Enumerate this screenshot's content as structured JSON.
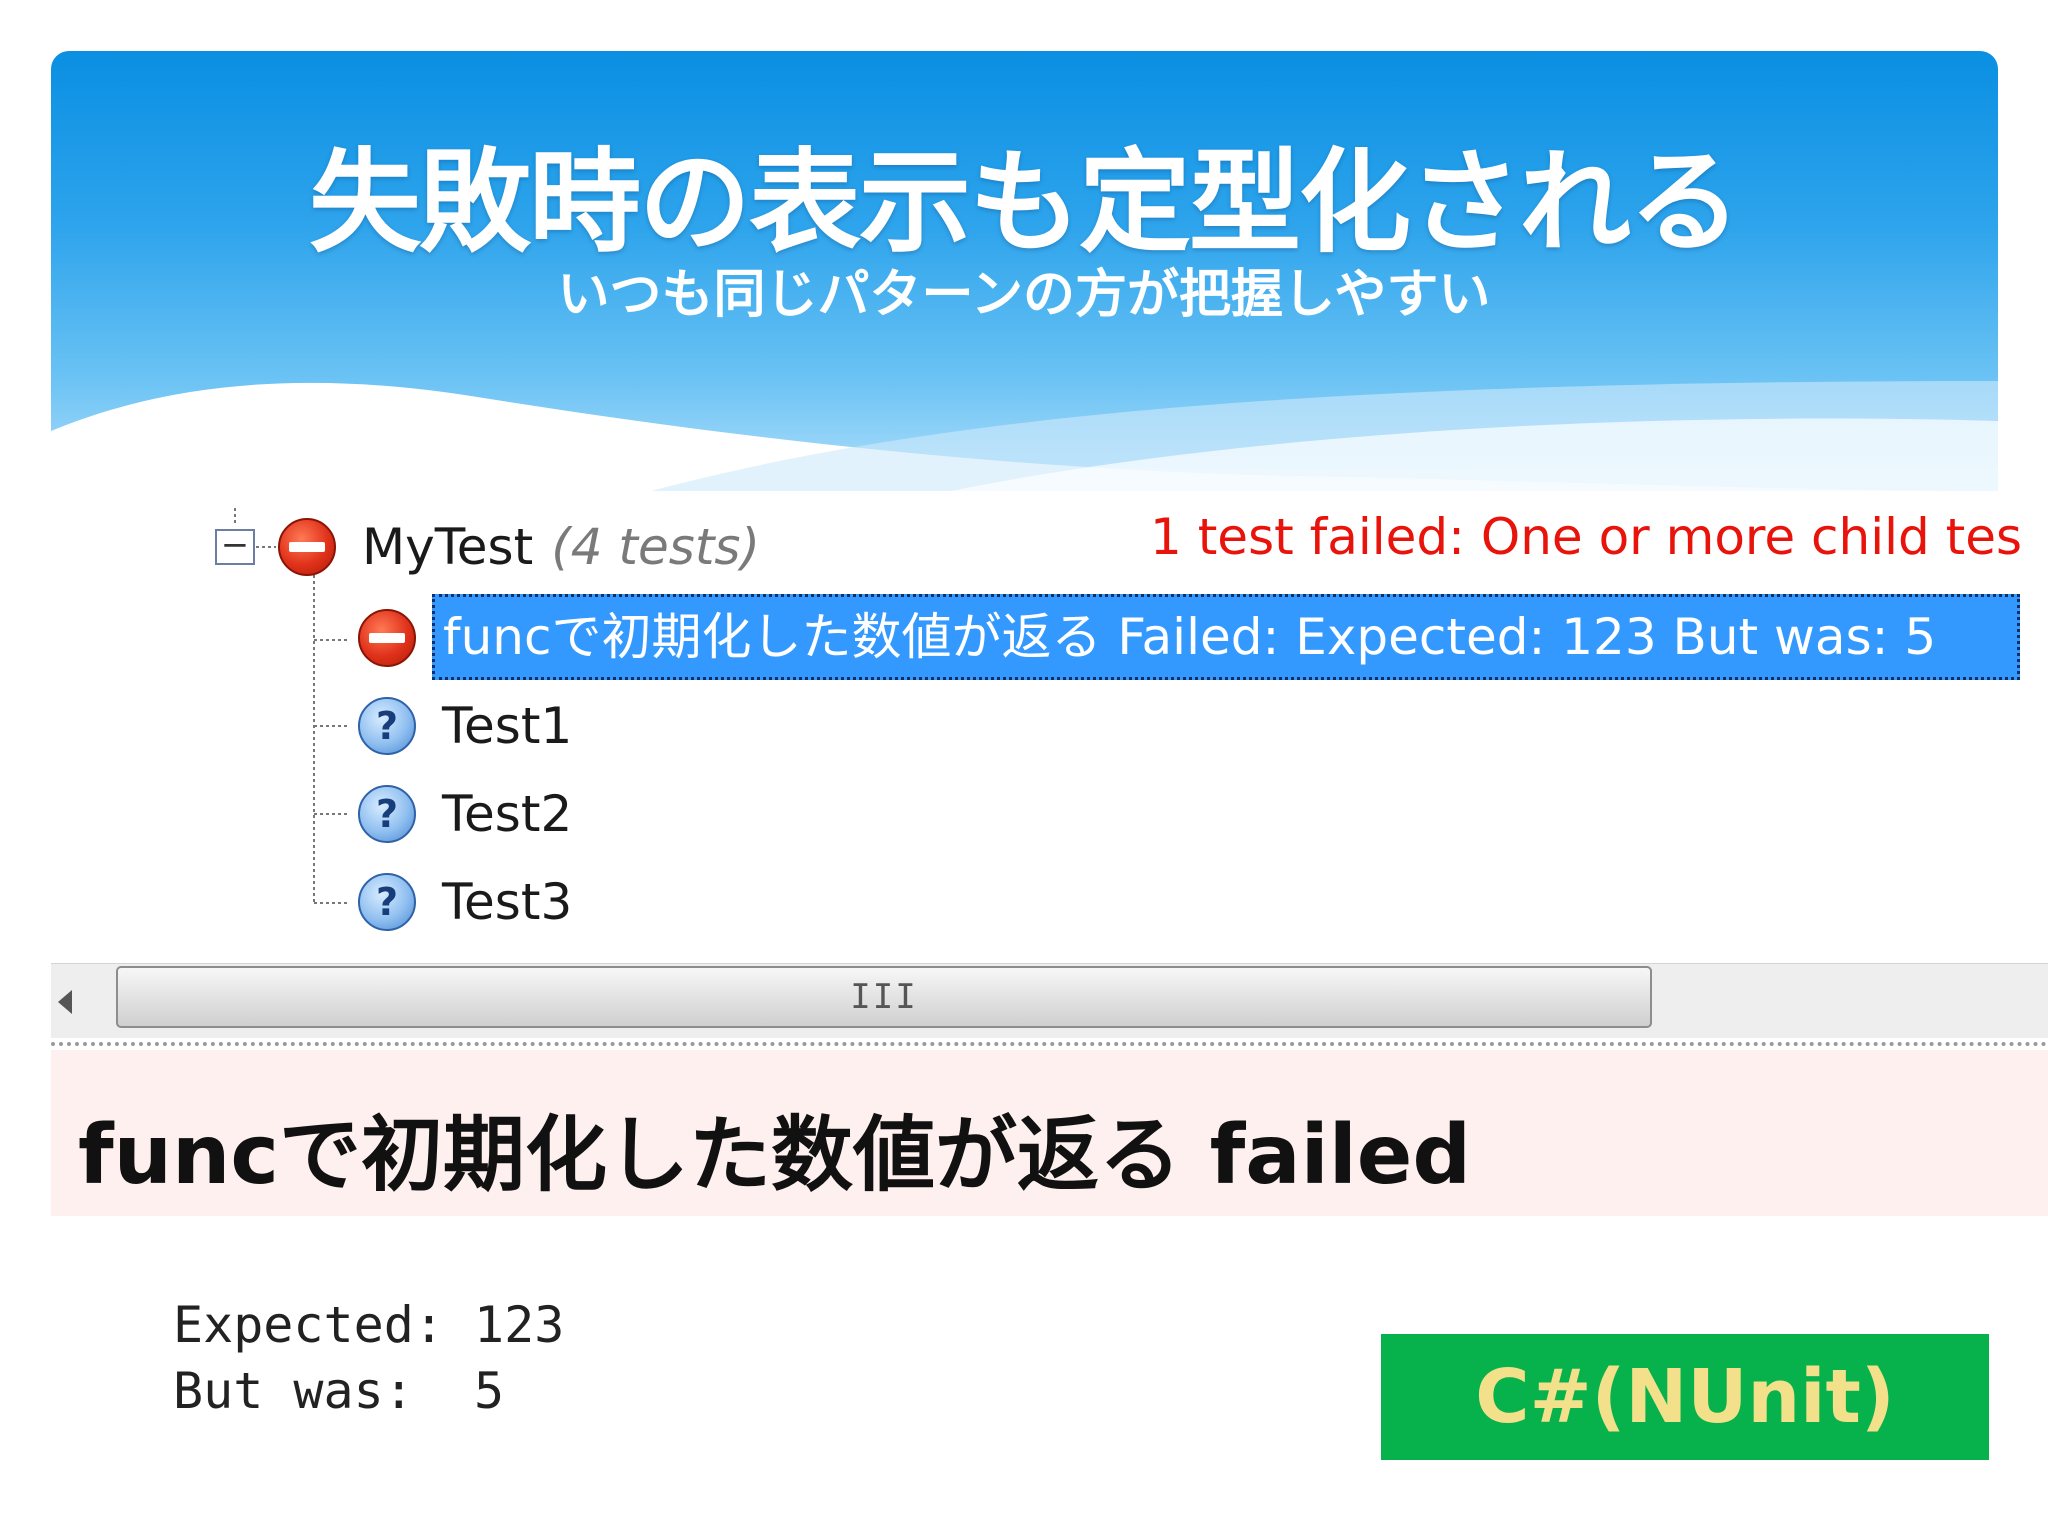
{
  "slide": {
    "title": "失敗時の表示も定型化される",
    "subtitle": "いつも同じパターンの方が把握しやすい"
  },
  "tree": {
    "collapse_symbol": "−",
    "root": {
      "name": "MyTest",
      "count": "(4 tests)",
      "status": "fail",
      "message": "1 test failed: One or more child tes"
    },
    "children": [
      {
        "label": "funcで初期化した数値が返る  Failed:  Expected: 123 But was: 5",
        "status": "fail",
        "selected": true
      },
      {
        "label": "Test1",
        "status": "unknown"
      },
      {
        "label": "Test2",
        "status": "unknown"
      },
      {
        "label": "Test3",
        "status": "unknown"
      }
    ],
    "unknown_glyph": "?"
  },
  "scrollbar": {
    "grip": "III"
  },
  "failure": {
    "heading": "funcで初期化した数値が返る failed",
    "expected_line": "Expected: 123",
    "actual_line": "But was:  5"
  },
  "badge": {
    "label": "C#(NUnit)"
  },
  "colors": {
    "banner_top": "#0a8fe2",
    "selection": "#3399ff",
    "fail_text": "#e8140c",
    "fail_panel": "#fdf0ee",
    "badge_bg": "#07b14b",
    "badge_text": "#f3e08a"
  }
}
